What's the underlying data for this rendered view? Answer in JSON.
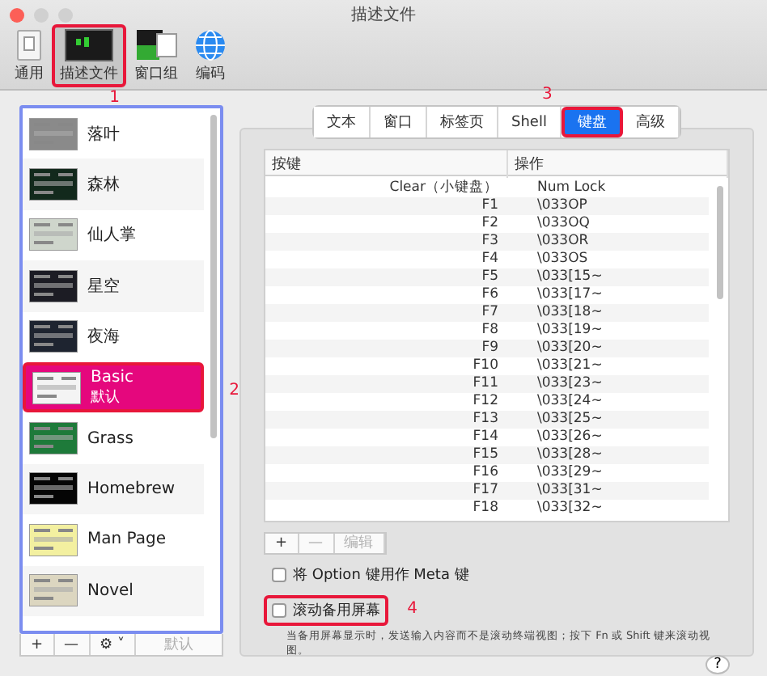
{
  "window": {
    "title": "描述文件"
  },
  "toolbar": [
    {
      "label": "通用",
      "kind": "general",
      "selected": false
    },
    {
      "label": "描述文件",
      "kind": "profiles",
      "selected": true,
      "annotation": "1"
    },
    {
      "label": "窗口组",
      "kind": "groups",
      "selected": false
    },
    {
      "label": "编码",
      "kind": "encoding",
      "selected": false
    }
  ],
  "profiles": {
    "outlined": true,
    "items": [
      {
        "name": "落叶",
        "color": "#8a8a8a",
        "selected": false
      },
      {
        "name": "森林",
        "color": "#12291c",
        "selected": false
      },
      {
        "name": "仙人掌",
        "color": "#cfd6cc",
        "selected": false
      },
      {
        "name": "星空",
        "color": "#1c1c24",
        "selected": false
      },
      {
        "name": "夜海",
        "color": "#1e2430",
        "selected": false
      },
      {
        "name": "Basic",
        "subtitle": "默认",
        "color": "#f4f4f4",
        "selected": true,
        "annotation": "2"
      },
      {
        "name": "Grass",
        "color": "#1e7a3a",
        "selected": false
      },
      {
        "name": "Homebrew",
        "color": "#050505",
        "selected": false
      },
      {
        "name": "Man Page",
        "color": "#f3f0a0",
        "selected": false
      },
      {
        "name": "Novel",
        "color": "#dcd6c0",
        "selected": false
      }
    ],
    "buttons": [
      {
        "label": "+",
        "disabled": false
      },
      {
        "label": "—",
        "disabled": false
      },
      {
        "label": "⚙ ˅",
        "disabled": false
      },
      {
        "label": "默认",
        "disabled": true
      }
    ]
  },
  "tabs": [
    {
      "label": "文本",
      "selected": false
    },
    {
      "label": "窗口",
      "selected": false
    },
    {
      "label": "标签页",
      "selected": false
    },
    {
      "label": "Shell",
      "selected": false
    },
    {
      "label": "键盘",
      "selected": true,
      "annotation": "3"
    },
    {
      "label": "高级",
      "selected": false
    }
  ],
  "table": {
    "columns": [
      "按键",
      "操作"
    ],
    "rows": [
      [
        "Clear（小键盘）",
        "Num Lock"
      ],
      [
        "F1",
        "\\033OP"
      ],
      [
        "F2",
        "\\033OQ"
      ],
      [
        "F3",
        "\\033OR"
      ],
      [
        "F4",
        "\\033OS"
      ],
      [
        "F5",
        "\\033[15~"
      ],
      [
        "F6",
        "\\033[17~"
      ],
      [
        "F7",
        "\\033[18~"
      ],
      [
        "F8",
        "\\033[19~"
      ],
      [
        "F9",
        "\\033[20~"
      ],
      [
        "F10",
        "\\033[21~"
      ],
      [
        "F11",
        "\\033[23~"
      ],
      [
        "F12",
        "\\033[24~"
      ],
      [
        "F13",
        "\\033[25~"
      ],
      [
        "F14",
        "\\033[26~"
      ],
      [
        "F15",
        "\\033[28~"
      ],
      [
        "F16",
        "\\033[29~"
      ],
      [
        "F17",
        "\\033[31~"
      ],
      [
        "F18",
        "\\033[32~"
      ]
    ]
  },
  "table_buttons": [
    {
      "label": "+",
      "disabled": false
    },
    {
      "label": "—",
      "disabled": true
    },
    {
      "label": "编辑",
      "disabled": true
    }
  ],
  "options": [
    {
      "label": "将 Option 键用作 Meta 键",
      "checked": false
    },
    {
      "label": "滚动备用屏幕",
      "checked": false,
      "annotation": "4"
    }
  ],
  "help_text": "当备用屏幕显示时，发送输入内容而不是滚动终端视图；按下 Fn 或 Shift 键来滚动视图。",
  "help_button": "?"
}
